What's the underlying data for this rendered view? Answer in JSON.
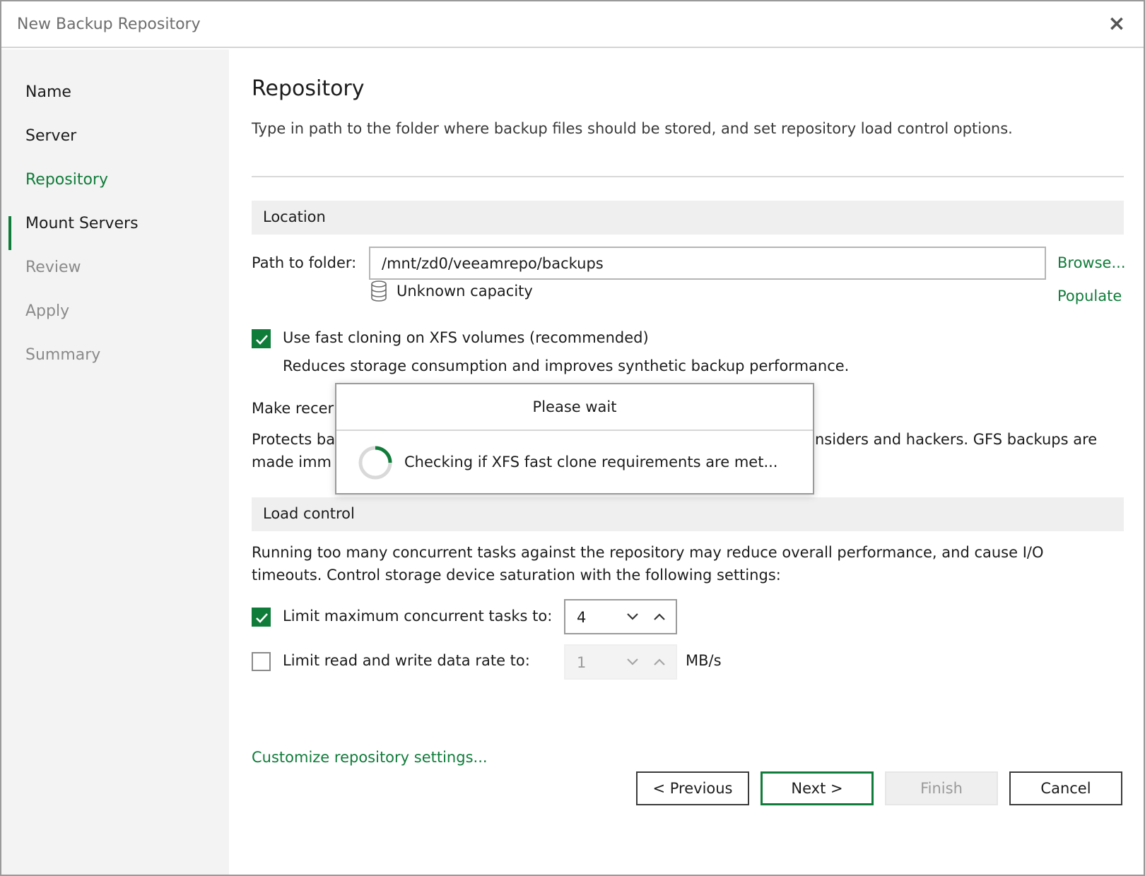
{
  "window": {
    "title": "New Backup Repository",
    "close_label": "×"
  },
  "sidebar": {
    "steps": [
      {
        "label": "Name",
        "state": "done"
      },
      {
        "label": "Server",
        "state": "done"
      },
      {
        "label": "Repository",
        "state": "active"
      },
      {
        "label": "Mount Servers",
        "state": "done"
      },
      {
        "label": "Review",
        "state": "pending"
      },
      {
        "label": "Apply",
        "state": "pending"
      },
      {
        "label": "Summary",
        "state": "pending"
      }
    ]
  },
  "main": {
    "heading": "Repository",
    "subtitle": "Type in path to the folder where backup files should be stored, and set repository load control options.",
    "location": {
      "section_title": "Location",
      "path_label": "Path to folder:",
      "path_value": "/mnt/zd0/veeamrepo/backups",
      "browse_label": "Browse...",
      "capacity_label": "Unknown capacity",
      "populate_label": "Populate",
      "fast_clone_label": "Use fast cloning on XFS volumes (recommended)",
      "fast_clone_checked": true,
      "fast_clone_desc": "Reduces storage consumption and improves synthetic backup performance.",
      "immutable_label_visible": "Make recer",
      "immutable_desc_line1_left": "Protects ba",
      "immutable_desc_line1_right": "nsiders and hackers. GFS backups are",
      "immutable_desc_line2_left": "made imm"
    },
    "load_control": {
      "section_title": "Load control",
      "desc_line1": "Running too many concurrent tasks against the repository may reduce overall performance, and cause I/O",
      "desc_line2": "timeouts. Control storage device saturation with the following settings:",
      "limit_tasks_label": "Limit maximum concurrent tasks to:",
      "limit_tasks_checked": true,
      "limit_tasks_value": "4",
      "limit_rate_label": "Limit read and write data rate to:",
      "limit_rate_checked": false,
      "limit_rate_value": "1",
      "limit_rate_unit": "MB/s"
    },
    "customize_link": "Customize repository settings..."
  },
  "buttons": {
    "previous": "< Previous",
    "next": "Next >",
    "finish": "Finish",
    "cancel": "Cancel"
  },
  "modal": {
    "title": "Please wait",
    "message": "Checking if XFS fast clone requirements are met..."
  },
  "colors": {
    "accent": "#107c3a",
    "sidebar_bg": "#f3f3f3",
    "section_bg": "#efefef"
  }
}
